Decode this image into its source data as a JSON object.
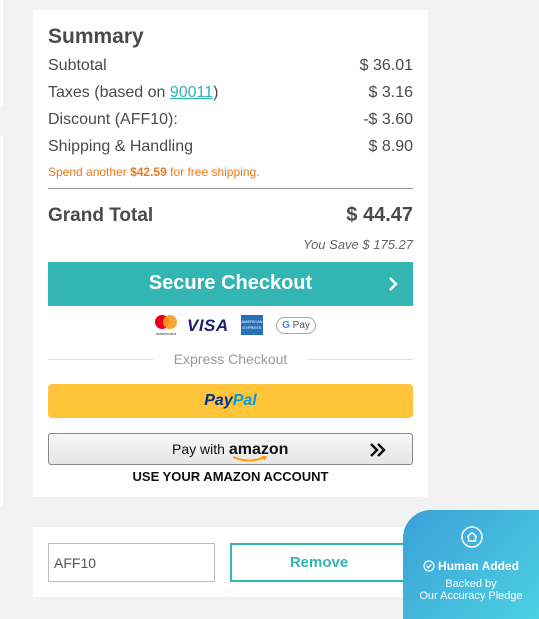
{
  "summary": {
    "title": "Summary",
    "subtotal_label": "Subtotal",
    "subtotal_value": "$ 36.01",
    "taxes_label_prefix": "Taxes (based on ",
    "taxes_zip": "90011",
    "taxes_label_suffix": ")",
    "taxes_value": "$ 3.16",
    "discount_label": "Discount (AFF10):",
    "discount_value": "-$ 3.60",
    "shipping_label": "Shipping & Handling",
    "shipping_value": "$ 8.90",
    "free_ship_prefix": "Spend another ",
    "free_ship_amount": "$42.59",
    "free_ship_suffix": " for free shipping.",
    "grand_total_label": "Grand Total",
    "grand_total_value": "$ 44.47",
    "you_save": "You Save $ 175.27"
  },
  "checkout": {
    "secure_label": "Secure Checkout",
    "express_label": "Express Checkout",
    "paypal_pay": "Pay",
    "paypal_pal": "Pal",
    "amazon_pay_with": "Pay with ",
    "amazon_brand": "amazon",
    "amazon_caption": "USE YOUR AMAZON ACCOUNT"
  },
  "payment_cards": {
    "mastercard_text": "mastercard",
    "visa": "VISA",
    "amex_line1": "AMERICAN",
    "amex_line2": "EXPRESS",
    "gpay_g": "G",
    "gpay_pay": " Pay"
  },
  "coupon": {
    "code_value": "AFF10",
    "remove_label": "Remove"
  },
  "badge": {
    "title": "Human Added",
    "line1": "Backed by",
    "line2": "Our Accuracy Pledge"
  },
  "colors": {
    "accent": "#33b5b3",
    "warning": "#e8791a",
    "paypal_yellow": "#ffc439",
    "badge_gradient_start": "#3aa0d8",
    "badge_gradient_end": "#4dd0e1"
  },
  "icons": [
    "chevron-right-icon",
    "mastercard-icon",
    "visa-icon",
    "amex-icon",
    "google-pay-icon",
    "double-chevron-right-icon",
    "home-icon",
    "check-circle-icon"
  ]
}
